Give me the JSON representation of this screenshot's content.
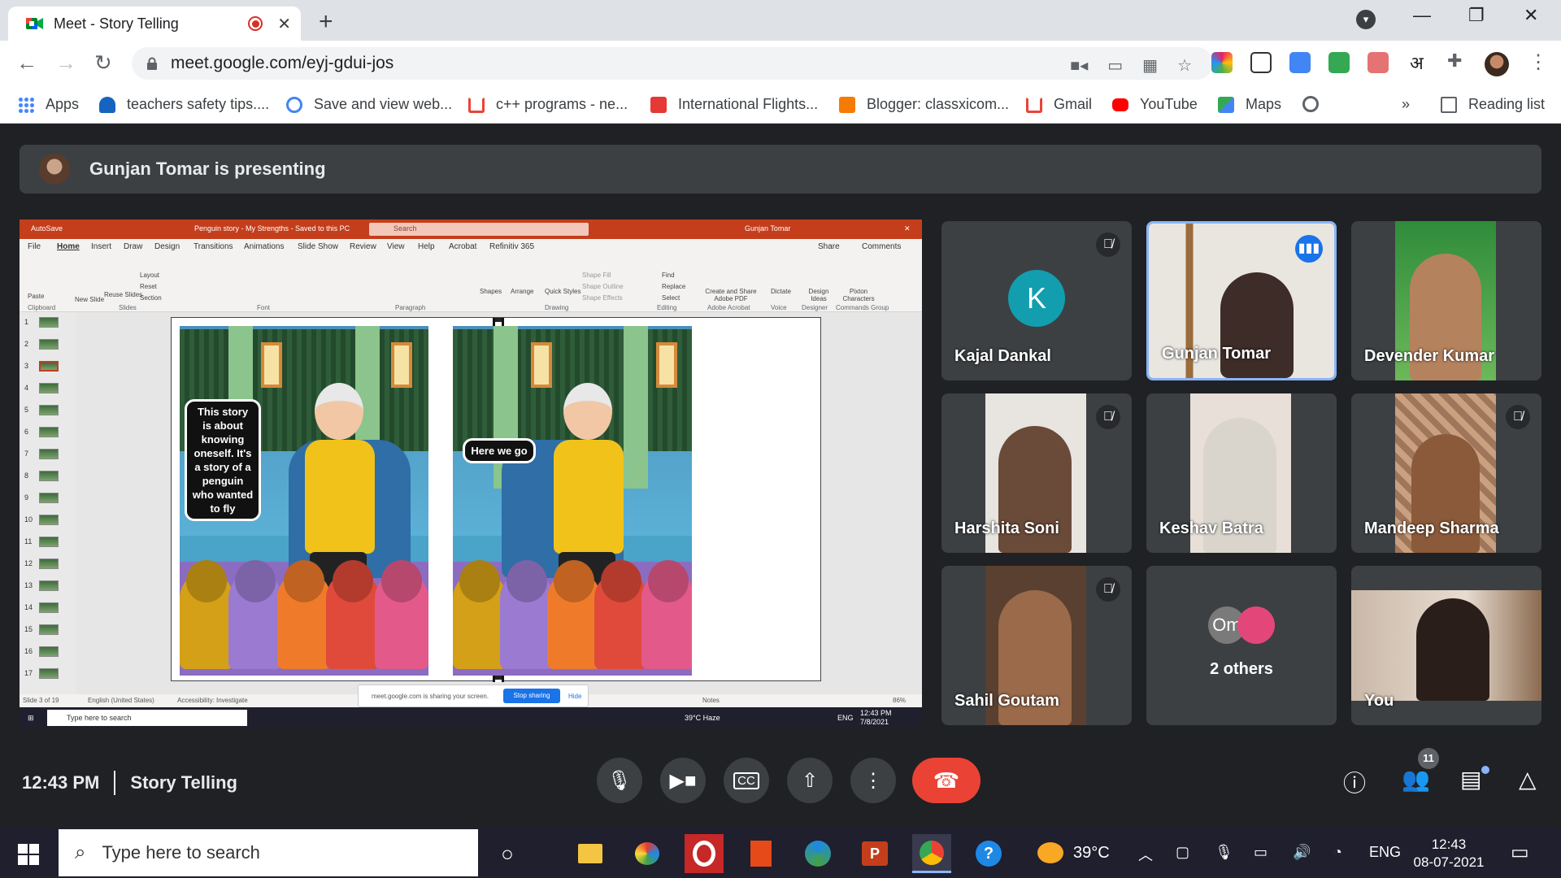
{
  "browser": {
    "tab_title": "Meet - Story Telling",
    "tab_close": "✕",
    "new_tab": "+",
    "url": "meet.google.com/eyj-gdui-jos",
    "extension_letter": "अ",
    "window": {
      "minimize": "—",
      "maximize": "❐",
      "close": "✕"
    },
    "bookmarks": [
      {
        "label": "Apps",
        "icon": "apps-icon",
        "color": "#4285f4"
      },
      {
        "label": "teachers safety tips....",
        "icon": "onedrive-icon",
        "color": "#1565c0"
      },
      {
        "label": "Save and view web...",
        "icon": "google-icon",
        "color": "#ea4335"
      },
      {
        "label": "c++ programs - ne...",
        "icon": "gmail-icon",
        "color": "#ea4335"
      },
      {
        "label": "International Flights...",
        "icon": "makemytrip-icon",
        "color": "#e53935"
      },
      {
        "label": "Blogger: classxicom...",
        "icon": "blogger-icon",
        "color": "#f57c00"
      },
      {
        "label": "Gmail",
        "icon": "gmail-icon",
        "color": "#ea4335"
      },
      {
        "label": "YouTube",
        "icon": "youtube-icon",
        "color": "#ff0000"
      },
      {
        "label": "Maps",
        "icon": "maps-icon",
        "color": "#34a853"
      }
    ],
    "bookmarks_more": "»",
    "reading_list": "Reading list"
  },
  "meet": {
    "presenting_text": "Gunjan Tomar is presenting",
    "time": "12:43 PM",
    "meeting_name": "Story Telling",
    "participant_count": "11",
    "tiles": [
      {
        "name": "Kajal Dankal",
        "initial": "K",
        "muted": true
      },
      {
        "name": "Gunjan Tomar",
        "muted": false,
        "speaking": true
      },
      {
        "name": "Devender Kumar",
        "muted": false
      },
      {
        "name": "Harshita Soni",
        "muted": true
      },
      {
        "name": "Keshav Batra",
        "muted": false
      },
      {
        "name": "Mandeep Sharma",
        "muted": true
      },
      {
        "name": "Sahil Goutam",
        "muted": true
      },
      {
        "name": "2 others",
        "avatar_initial": "Om"
      },
      {
        "name": "You",
        "muted": false
      }
    ]
  },
  "shared_screen": {
    "pp_autosave": "AutoSave",
    "pp_doc_title": "Penguin story - My Strengths - Saved to this PC",
    "pp_search": "Search",
    "pp_user": "Gunjan Tomar",
    "pp_menu": [
      "File",
      "Home",
      "Insert",
      "Draw",
      "Design",
      "Transitions",
      "Animations",
      "Slide Show",
      "Review",
      "View",
      "Help",
      "Acrobat",
      "Refinitiv 365"
    ],
    "pp_share": "Share",
    "pp_comments": "Comments",
    "ribbon_groups": [
      "Clipboard",
      "Slides",
      "Font",
      "Paragraph",
      "Drawing",
      "Editing",
      "Adobe Acrobat",
      "Voice",
      "Designer",
      "Commands Group"
    ],
    "ribbon_buttons": [
      "Paste",
      "New Slide",
      "Reuse Slides",
      "Layout",
      "Reset",
      "Section",
      "Shapes",
      "Arrange",
      "Quick Styles",
      "Shape Fill",
      "Shape Outline",
      "Shape Effects",
      "Find",
      "Replace",
      "Select",
      "Create and Share Adobe PDF",
      "Dictate",
      "Design Ideas",
      "Pixton Characters"
    ],
    "bubble_left": "This story is about knowing oneself. It's a story of a penguin who wanted to fly",
    "bubble_right": "Here we go",
    "status_slide": "Slide 3 of 19",
    "status_lang": "English (United States)",
    "status_access": "Accessibility: Investigate",
    "status_notes": "Notes",
    "status_zoom": "86%",
    "share_notice": "meet.google.com is sharing your screen.",
    "stop_sharing": "Stop sharing",
    "hide": "Hide",
    "inner_search": "Type here to search",
    "inner_weather": "39°C Haze",
    "inner_lang": "ENG",
    "inner_time": "12:43 PM",
    "inner_date": "7/8/2021"
  },
  "taskbar": {
    "search": "Type here to search",
    "temperature": "39°C",
    "lang": "ENG",
    "time": "12:43",
    "date": "08-07-2021"
  }
}
